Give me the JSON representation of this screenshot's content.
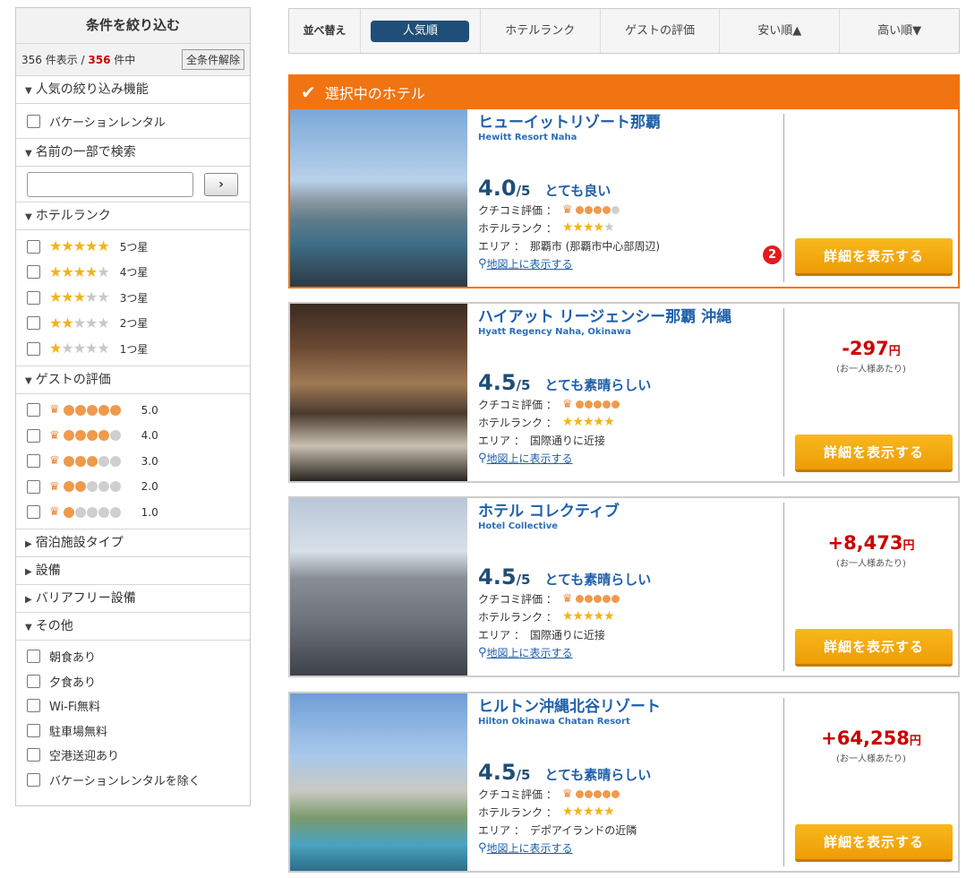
{
  "sidebar": {
    "title": "条件を絞り込む",
    "count_shown": "356 件表示 / ",
    "count_total": "356",
    "count_suffix": " 件中",
    "clear_label": "全条件解除",
    "sections": {
      "popular": "人気の絞り込み機能",
      "vacation_rental": "バケーションレンタル",
      "name_search": "名前の一部で検索",
      "search_go": "›",
      "hotel_rank": "ホテルランク",
      "guest_rating": "ゲストの評価",
      "facility_type": "宿泊施設タイプ",
      "amenities": "設備",
      "barrier_free": "バリアフリー設備",
      "other": "その他"
    },
    "rank_options": [
      {
        "label": "5つ星",
        "stars": 5
      },
      {
        "label": "4つ星",
        "stars": 4
      },
      {
        "label": "3つ星",
        "stars": 3
      },
      {
        "label": "2つ星",
        "stars": 2
      },
      {
        "label": "1つ星",
        "stars": 1
      }
    ],
    "rating_options": [
      {
        "label": "5.0",
        "dots": 5
      },
      {
        "label": "4.0",
        "dots": 4
      },
      {
        "label": "3.0",
        "dots": 3
      },
      {
        "label": "2.0",
        "dots": 2
      },
      {
        "label": "1.0",
        "dots": 1
      }
    ],
    "other_options": [
      "朝食あり",
      "夕食あり",
      "Wi-Fi無料",
      "駐車場無料",
      "空港送迎あり",
      "バケーションレンタルを除く"
    ]
  },
  "sortbar": {
    "label": "並べ替え",
    "items": [
      "人気順",
      "ホテルランク",
      "ゲストの評価",
      "安い順▲",
      "高い順▼"
    ]
  },
  "selected_header": "選択中のホテル",
  "labels": {
    "review": "クチコミ評価 ：",
    "rank": "ホテルランク ：",
    "area": "エリア ：",
    "map": "地図上に表示する",
    "detail": "詳細を表示する",
    "per_person": "(お一人様あたり)",
    "yen": "円",
    "badge": "2"
  },
  "hotels": [
    {
      "name_ja": "ヒューイットリゾート那覇",
      "name_en": "Hewitt Resort Naha",
      "score": "4.0",
      "score_den": "/5",
      "score_word": "とても良い",
      "area": "那覇市 (那覇市中心部周辺)",
      "price": ""
    },
    {
      "name_ja": "ハイアット リージェンシー那覇 沖縄",
      "name_en": "Hyatt Regency Naha, Okinawa",
      "score": "4.5",
      "score_den": "/5",
      "score_word": "とても素晴らしい",
      "area": "国際通りに近接",
      "price": "-297"
    },
    {
      "name_ja": "ホテル コレクティブ",
      "name_en": "Hotel Collective",
      "score": "4.5",
      "score_den": "/5",
      "score_word": "とても素晴らしい",
      "area": "国際通りに近接",
      "price": "+8,473"
    },
    {
      "name_ja": "ヒルトン沖縄北谷リゾート",
      "name_en": "Hilton Okinawa Chatan Resort",
      "score": "4.5",
      "score_den": "/5",
      "score_word": "とても素晴らしい",
      "area": "デポアイランドの近隣",
      "price": "+64,258"
    }
  ]
}
